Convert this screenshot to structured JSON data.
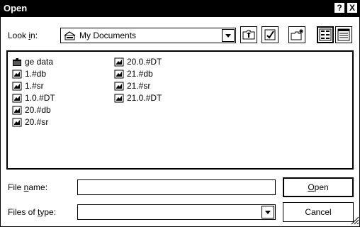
{
  "window": {
    "title": "Open"
  },
  "title_buttons": {
    "help": "?",
    "close": "X"
  },
  "look_in": {
    "label_pre": "Look ",
    "label_acc": "i",
    "label_post": "n:",
    "value": "My Documents",
    "icon": "my-documents-icon"
  },
  "toolbar": {
    "icons": [
      "up-one-level-icon",
      "create-new-folder-icon",
      "list-view-icon",
      "details-view-icon"
    ]
  },
  "files": {
    "column1": [
      {
        "name": "ge data",
        "type": "folder"
      },
      {
        "name": "1.#db",
        "type": "file"
      },
      {
        "name": "1.#sr",
        "type": "file"
      },
      {
        "name": "1.0.#DT",
        "type": "file"
      },
      {
        "name": "20.#db",
        "type": "file"
      },
      {
        "name": "20.#sr",
        "type": "file"
      }
    ],
    "column2": [
      {
        "name": "20.0.#DT",
        "type": "file"
      },
      {
        "name": "21.#db",
        "type": "file"
      },
      {
        "name": "21.#sr",
        "type": "file"
      },
      {
        "name": "21.0.#DT",
        "type": "file"
      }
    ]
  },
  "file_name": {
    "label_pre": "File ",
    "label_acc": "n",
    "label_post": "ame:",
    "value": ""
  },
  "files_of_type": {
    "label_pre": "Files of ",
    "label_acc": "t",
    "label_post": "ype:",
    "value": ""
  },
  "buttons": {
    "open_acc": "O",
    "open_rest": "pen",
    "cancel": "Cancel"
  }
}
